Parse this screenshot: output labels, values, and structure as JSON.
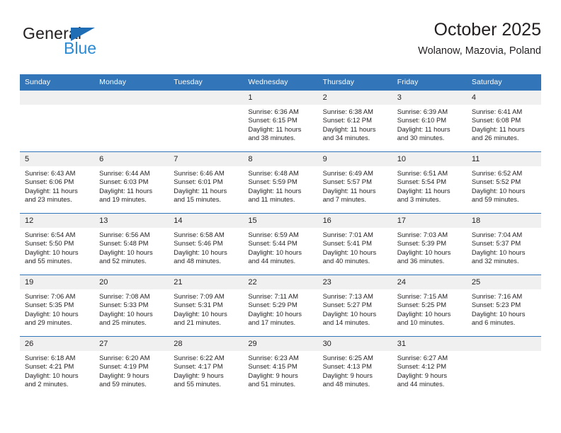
{
  "brand": {
    "name_line1": "General",
    "name_line2": "Blue",
    "color_dark": "#231f20",
    "color_blue": "#2a8bd4",
    "triangle_color": "#1f6db5"
  },
  "header": {
    "title": "October 2025",
    "subtitle": "Wolanow, Mazovia, Poland"
  },
  "theme": {
    "header_row_bg": "#3275b8",
    "header_row_text": "#ffffff",
    "daynum_bg": "#f0f0f0",
    "row_divider": "#3275b8"
  },
  "weekdays": [
    "Sunday",
    "Monday",
    "Tuesday",
    "Wednesday",
    "Thursday",
    "Friday",
    "Saturday"
  ],
  "labels": {
    "sunrise_prefix": "Sunrise:",
    "sunset_prefix": "Sunset:",
    "daylight_prefix": "Daylight:"
  },
  "weeks": [
    [
      {
        "day": "",
        "blank": true
      },
      {
        "day": "",
        "blank": true
      },
      {
        "day": "",
        "blank": true
      },
      {
        "day": "1",
        "sunrise": "Sunrise: 6:36 AM",
        "sunset": "Sunset: 6:15 PM",
        "daylight_1": "Daylight: 11 hours",
        "daylight_2": "and 38 minutes."
      },
      {
        "day": "2",
        "sunrise": "Sunrise: 6:38 AM",
        "sunset": "Sunset: 6:12 PM",
        "daylight_1": "Daylight: 11 hours",
        "daylight_2": "and 34 minutes."
      },
      {
        "day": "3",
        "sunrise": "Sunrise: 6:39 AM",
        "sunset": "Sunset: 6:10 PM",
        "daylight_1": "Daylight: 11 hours",
        "daylight_2": "and 30 minutes."
      },
      {
        "day": "4",
        "sunrise": "Sunrise: 6:41 AM",
        "sunset": "Sunset: 6:08 PM",
        "daylight_1": "Daylight: 11 hours",
        "daylight_2": "and 26 minutes."
      }
    ],
    [
      {
        "day": "5",
        "sunrise": "Sunrise: 6:43 AM",
        "sunset": "Sunset: 6:06 PM",
        "daylight_1": "Daylight: 11 hours",
        "daylight_2": "and 23 minutes."
      },
      {
        "day": "6",
        "sunrise": "Sunrise: 6:44 AM",
        "sunset": "Sunset: 6:03 PM",
        "daylight_1": "Daylight: 11 hours",
        "daylight_2": "and 19 minutes."
      },
      {
        "day": "7",
        "sunrise": "Sunrise: 6:46 AM",
        "sunset": "Sunset: 6:01 PM",
        "daylight_1": "Daylight: 11 hours",
        "daylight_2": "and 15 minutes."
      },
      {
        "day": "8",
        "sunrise": "Sunrise: 6:48 AM",
        "sunset": "Sunset: 5:59 PM",
        "daylight_1": "Daylight: 11 hours",
        "daylight_2": "and 11 minutes."
      },
      {
        "day": "9",
        "sunrise": "Sunrise: 6:49 AM",
        "sunset": "Sunset: 5:57 PM",
        "daylight_1": "Daylight: 11 hours",
        "daylight_2": "and 7 minutes."
      },
      {
        "day": "10",
        "sunrise": "Sunrise: 6:51 AM",
        "sunset": "Sunset: 5:54 PM",
        "daylight_1": "Daylight: 11 hours",
        "daylight_2": "and 3 minutes."
      },
      {
        "day": "11",
        "sunrise": "Sunrise: 6:52 AM",
        "sunset": "Sunset: 5:52 PM",
        "daylight_1": "Daylight: 10 hours",
        "daylight_2": "and 59 minutes."
      }
    ],
    [
      {
        "day": "12",
        "sunrise": "Sunrise: 6:54 AM",
        "sunset": "Sunset: 5:50 PM",
        "daylight_1": "Daylight: 10 hours",
        "daylight_2": "and 55 minutes."
      },
      {
        "day": "13",
        "sunrise": "Sunrise: 6:56 AM",
        "sunset": "Sunset: 5:48 PM",
        "daylight_1": "Daylight: 10 hours",
        "daylight_2": "and 52 minutes."
      },
      {
        "day": "14",
        "sunrise": "Sunrise: 6:58 AM",
        "sunset": "Sunset: 5:46 PM",
        "daylight_1": "Daylight: 10 hours",
        "daylight_2": "and 48 minutes."
      },
      {
        "day": "15",
        "sunrise": "Sunrise: 6:59 AM",
        "sunset": "Sunset: 5:44 PM",
        "daylight_1": "Daylight: 10 hours",
        "daylight_2": "and 44 minutes."
      },
      {
        "day": "16",
        "sunrise": "Sunrise: 7:01 AM",
        "sunset": "Sunset: 5:41 PM",
        "daylight_1": "Daylight: 10 hours",
        "daylight_2": "and 40 minutes."
      },
      {
        "day": "17",
        "sunrise": "Sunrise: 7:03 AM",
        "sunset": "Sunset: 5:39 PM",
        "daylight_1": "Daylight: 10 hours",
        "daylight_2": "and 36 minutes."
      },
      {
        "day": "18",
        "sunrise": "Sunrise: 7:04 AM",
        "sunset": "Sunset: 5:37 PM",
        "daylight_1": "Daylight: 10 hours",
        "daylight_2": "and 32 minutes."
      }
    ],
    [
      {
        "day": "19",
        "sunrise": "Sunrise: 7:06 AM",
        "sunset": "Sunset: 5:35 PM",
        "daylight_1": "Daylight: 10 hours",
        "daylight_2": "and 29 minutes."
      },
      {
        "day": "20",
        "sunrise": "Sunrise: 7:08 AM",
        "sunset": "Sunset: 5:33 PM",
        "daylight_1": "Daylight: 10 hours",
        "daylight_2": "and 25 minutes."
      },
      {
        "day": "21",
        "sunrise": "Sunrise: 7:09 AM",
        "sunset": "Sunset: 5:31 PM",
        "daylight_1": "Daylight: 10 hours",
        "daylight_2": "and 21 minutes."
      },
      {
        "day": "22",
        "sunrise": "Sunrise: 7:11 AM",
        "sunset": "Sunset: 5:29 PM",
        "daylight_1": "Daylight: 10 hours",
        "daylight_2": "and 17 minutes."
      },
      {
        "day": "23",
        "sunrise": "Sunrise: 7:13 AM",
        "sunset": "Sunset: 5:27 PM",
        "daylight_1": "Daylight: 10 hours",
        "daylight_2": "and 14 minutes."
      },
      {
        "day": "24",
        "sunrise": "Sunrise: 7:15 AM",
        "sunset": "Sunset: 5:25 PM",
        "daylight_1": "Daylight: 10 hours",
        "daylight_2": "and 10 minutes."
      },
      {
        "day": "25",
        "sunrise": "Sunrise: 7:16 AM",
        "sunset": "Sunset: 5:23 PM",
        "daylight_1": "Daylight: 10 hours",
        "daylight_2": "and 6 minutes."
      }
    ],
    [
      {
        "day": "26",
        "sunrise": "Sunrise: 6:18 AM",
        "sunset": "Sunset: 4:21 PM",
        "daylight_1": "Daylight: 10 hours",
        "daylight_2": "and 2 minutes."
      },
      {
        "day": "27",
        "sunrise": "Sunrise: 6:20 AM",
        "sunset": "Sunset: 4:19 PM",
        "daylight_1": "Daylight: 9 hours",
        "daylight_2": "and 59 minutes."
      },
      {
        "day": "28",
        "sunrise": "Sunrise: 6:22 AM",
        "sunset": "Sunset: 4:17 PM",
        "daylight_1": "Daylight: 9 hours",
        "daylight_2": "and 55 minutes."
      },
      {
        "day": "29",
        "sunrise": "Sunrise: 6:23 AM",
        "sunset": "Sunset: 4:15 PM",
        "daylight_1": "Daylight: 9 hours",
        "daylight_2": "and 51 minutes."
      },
      {
        "day": "30",
        "sunrise": "Sunrise: 6:25 AM",
        "sunset": "Sunset: 4:13 PM",
        "daylight_1": "Daylight: 9 hours",
        "daylight_2": "and 48 minutes."
      },
      {
        "day": "31",
        "sunrise": "Sunrise: 6:27 AM",
        "sunset": "Sunset: 4:12 PM",
        "daylight_1": "Daylight: 9 hours",
        "daylight_2": "and 44 minutes."
      },
      {
        "day": "",
        "blank": true
      }
    ]
  ]
}
